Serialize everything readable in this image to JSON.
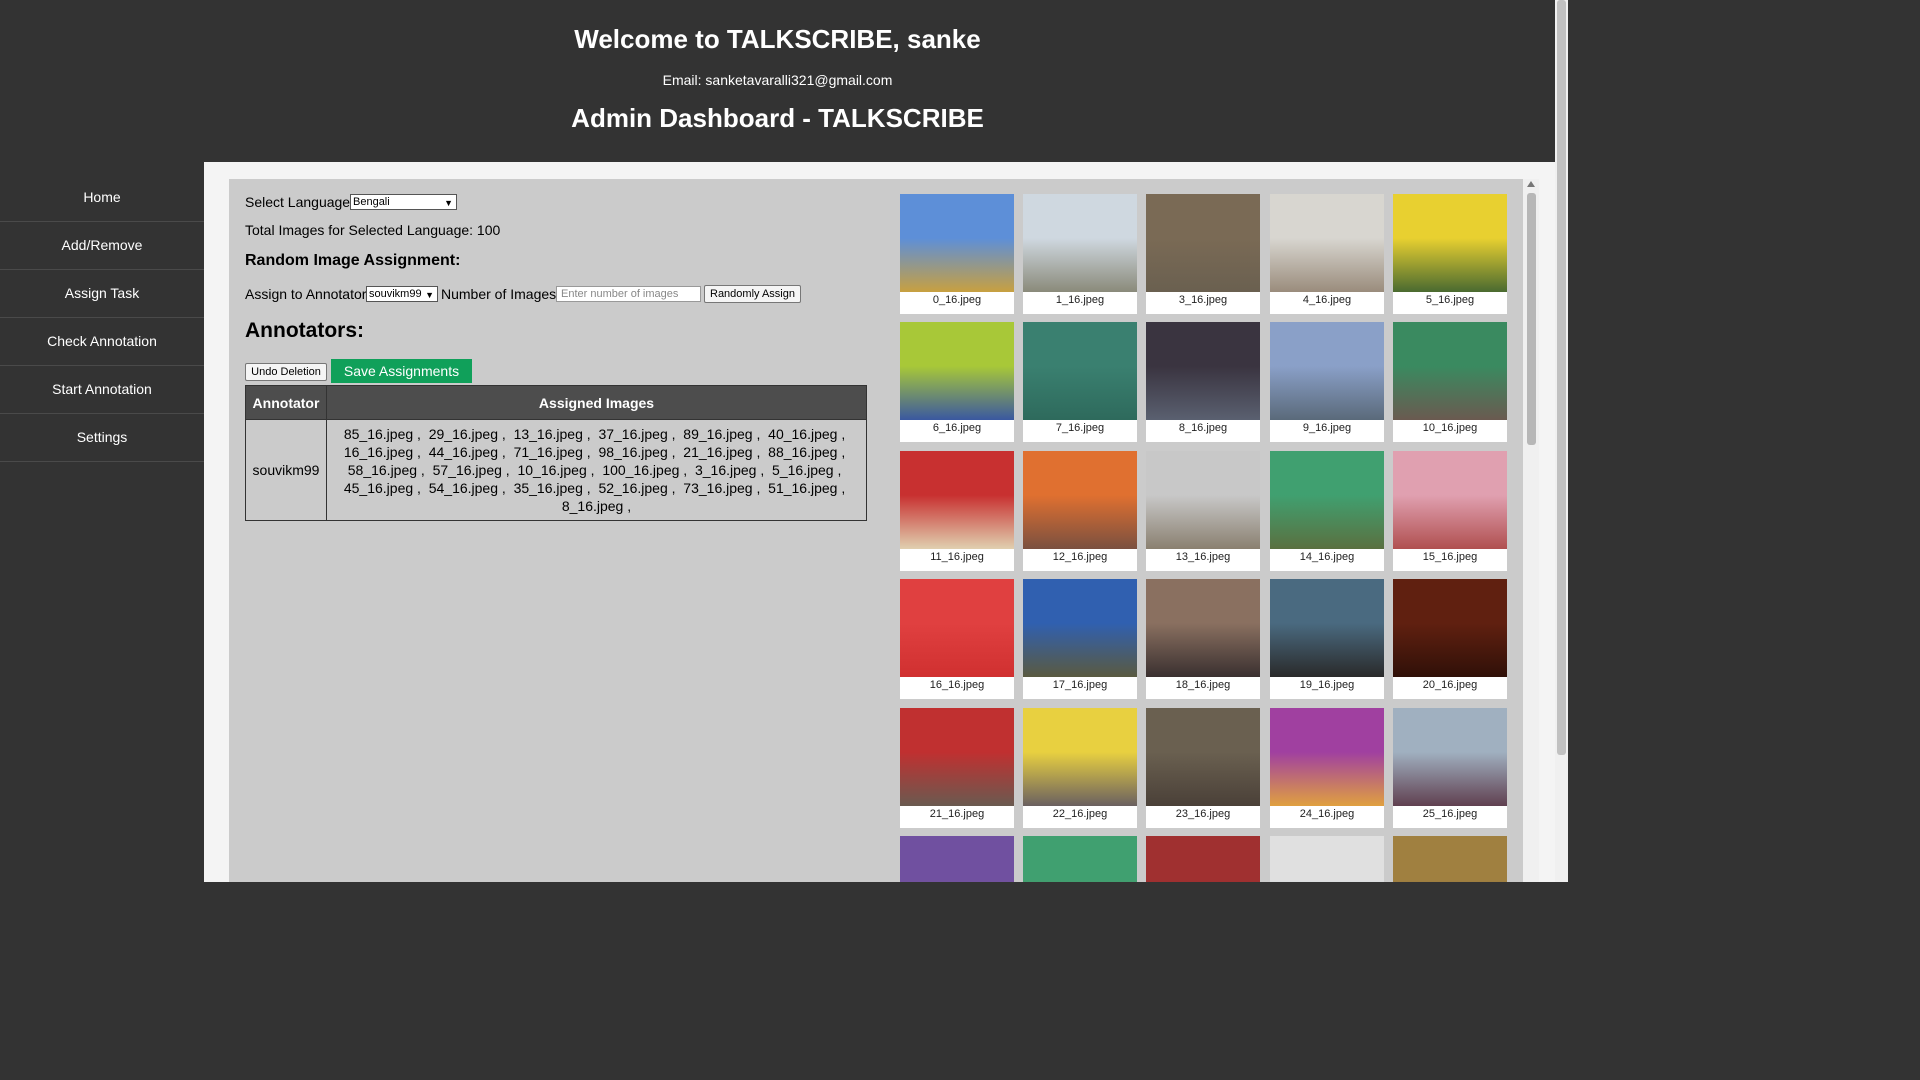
{
  "header": {
    "welcome": "Welcome to TALKSCRIBE, sanke",
    "email": "Email: sanketavaralli321@gmail.com",
    "admin_title": "Admin Dashboard - TALKSCRIBE"
  },
  "sidebar": {
    "items": [
      {
        "label": "Home"
      },
      {
        "label": "Add/Remove"
      },
      {
        "label": "Assign Task"
      },
      {
        "label": "Check Annotation"
      },
      {
        "label": "Start Annotation"
      },
      {
        "label": "Settings"
      }
    ]
  },
  "main": {
    "select_language_label": "Select Language:",
    "language_value": "Bengali",
    "total_images_text": "Total Images for Selected Language: 100",
    "random_heading": "Random Image Assignment:",
    "assign_to_label": "Assign to Annotator:",
    "annotator_value": "souvikm99",
    "number_label": "Number of Images:",
    "number_placeholder": "Enter number of images",
    "randomly_assign_label": "Randomly Assign",
    "annotators_heading": "Annotators:",
    "undo_label": "Undo Deletion",
    "save_label": "Save Assignments",
    "table": {
      "col_annotator": "Annotator",
      "col_assigned": "Assigned Images",
      "annotator": "souvikm99",
      "images": [
        "85_16.jpeg",
        "29_16.jpeg",
        "13_16.jpeg",
        "37_16.jpeg",
        "89_16.jpeg",
        "40_16.jpeg",
        "16_16.jpeg",
        "44_16.jpeg",
        "71_16.jpeg",
        "98_16.jpeg",
        "21_16.jpeg",
        "88_16.jpeg",
        "58_16.jpeg",
        "57_16.jpeg",
        "10_16.jpeg",
        "100_16.jpeg",
        "3_16.jpeg",
        "5_16.jpeg",
        "45_16.jpeg",
        "54_16.jpeg",
        "35_16.jpeg",
        "52_16.jpeg",
        "73_16.jpeg",
        "51_16.jpeg",
        "8_16.jpeg"
      ]
    }
  },
  "gallery": [
    {
      "name": "0_16.jpeg",
      "top": "#5d8fd8",
      "bottom": "#c8a040"
    },
    {
      "name": "1_16.jpeg",
      "top": "#cfd8e0",
      "bottom": "#8a8a7a"
    },
    {
      "name": "3_16.jpeg",
      "top": "#7a6a55",
      "bottom": "#6a6050"
    },
    {
      "name": "4_16.jpeg",
      "top": "#d8d6d0",
      "bottom": "#9a8c7c"
    },
    {
      "name": "5_16.jpeg",
      "top": "#e8d030",
      "bottom": "#4a6a30"
    },
    {
      "name": "6_16.jpeg",
      "top": "#a8c838",
      "bottom": "#3a58a0"
    },
    {
      "name": "7_16.jpeg",
      "top": "#3a8070",
      "bottom": "#2e6a5c"
    },
    {
      "name": "8_16.jpeg",
      "top": "#3a3440",
      "bottom": "#5a6070"
    },
    {
      "name": "9_16.jpeg",
      "top": "#8aa0c8",
      "bottom": "#5a6a7a"
    },
    {
      "name": "10_16.jpeg",
      "top": "#3a8a60",
      "bottom": "#6a5a50"
    },
    {
      "name": "11_16.jpeg",
      "top": "#c83030",
      "bottom": "#e0d0b0"
    },
    {
      "name": "12_16.jpeg",
      "top": "#e07030",
      "bottom": "#7a5040"
    },
    {
      "name": "13_16.jpeg",
      "top": "#c8c8c8",
      "bottom": "#8a8070"
    },
    {
      "name": "14_16.jpeg",
      "top": "#40a070",
      "bottom": "#5a7040"
    },
    {
      "name": "15_16.jpeg",
      "top": "#e0a0b0",
      "bottom": "#b05050"
    },
    {
      "name": "16_16.jpeg",
      "top": "#e04040",
      "bottom": "#d03030"
    },
    {
      "name": "17_16.jpeg",
      "top": "#3060b0",
      "bottom": "#5a5a40"
    },
    {
      "name": "18_16.jpeg",
      "top": "#8a7060",
      "bottom": "#3a3030"
    },
    {
      "name": "19_16.jpeg",
      "top": "#4a6a80",
      "bottom": "#2a2a2a"
    },
    {
      "name": "20_16.jpeg",
      "top": "#602010",
      "bottom": "#301008"
    },
    {
      "name": "21_16.jpeg",
      "top": "#c03030",
      "bottom": "#6a5a50"
    },
    {
      "name": "22_16.jpeg",
      "top": "#e8d040",
      "bottom": "#6a6060"
    },
    {
      "name": "23_16.jpeg",
      "top": "#6a6050",
      "bottom": "#4a4038"
    },
    {
      "name": "24_16.jpeg",
      "top": "#a040a0",
      "bottom": "#e0a040"
    },
    {
      "name": "25_16.jpeg",
      "top": "#a0b0c0",
      "bottom": "#604050"
    },
    {
      "name": "",
      "top": "#7050a0",
      "bottom": "#d0b040"
    },
    {
      "name": "",
      "top": "#40a070",
      "bottom": "#c05050"
    },
    {
      "name": "",
      "top": "#a03030",
      "bottom": "#403030"
    },
    {
      "name": "",
      "top": "#e0e0e0",
      "bottom": "#5080c0"
    },
    {
      "name": "",
      "top": "#a08040",
      "bottom": "#604030"
    }
  ]
}
